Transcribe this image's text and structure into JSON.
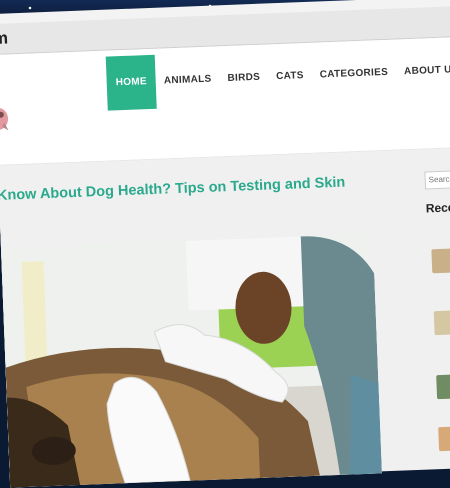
{
  "browser": {
    "url_fragment": "m"
  },
  "nav": {
    "items": [
      "HOME",
      "ANIMALS",
      "BIRDS",
      "CATS",
      "CATEGORIES",
      "ABOUT US"
    ],
    "active": "HOME",
    "accent": "#2bb38a"
  },
  "post": {
    "title": "Know About Dog Health? Tips on Testing and Skin"
  },
  "sidebar": {
    "search_placeholder": "Search",
    "recent_heading": "Rece"
  }
}
